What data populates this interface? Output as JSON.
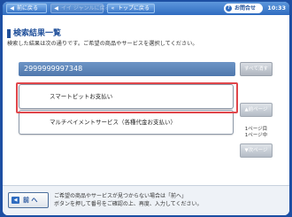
{
  "topbar": {
    "back_label": "前に戻る",
    "genre_label": "イイ ジャンルに戻る",
    "top_label": "トップに戻る",
    "inquiry_label": "お問合せ",
    "clock": "10:33"
  },
  "page": {
    "title": "検索結果一覧",
    "subtitle": "検索した結果は次の通りです。ご希望の商品やサービスを選択してください。"
  },
  "search": {
    "value": "2999999997348",
    "clear_label": "すべて消す"
  },
  "results": [
    {
      "label": "スマートピットお支払い"
    },
    {
      "label": "マルチペイメントサービス（各種代金お支払い）"
    }
  ],
  "pager": {
    "prev_label": "▲前ページ",
    "page_info_line1": "1ページ目",
    "page_info_line2": "1ページ中",
    "next_label": "▼次ページ"
  },
  "footer": {
    "back_label": "前 へ",
    "line1": "ご希望の商品やサービスが見つからない場合は「前へ」",
    "line2": "ボタンを押して番号をご確認の上、再度、入力してください。"
  },
  "colors": {
    "brand": "#1d4fa3",
    "highlight": "#e0464b"
  }
}
